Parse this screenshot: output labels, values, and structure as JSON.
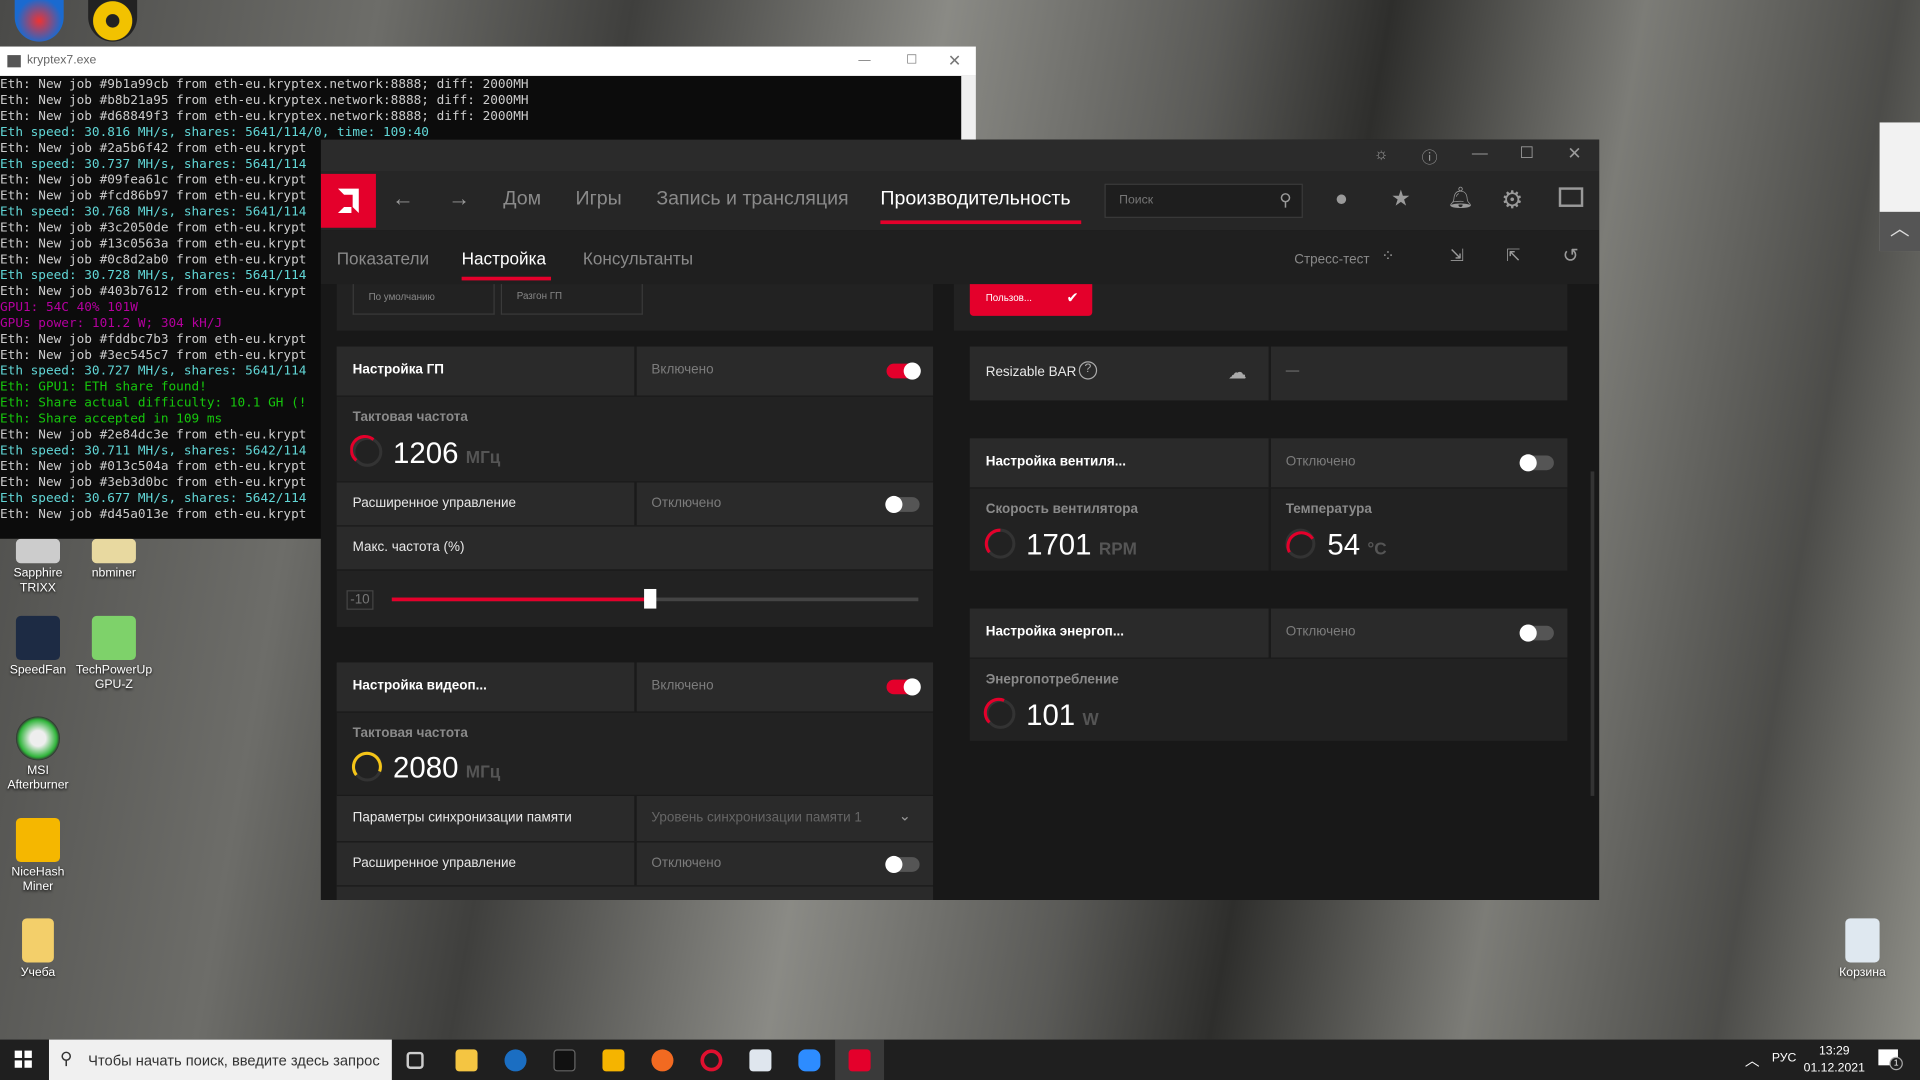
{
  "desktop": {
    "icons": [
      "Sapphire TRIXX",
      "nbminer",
      "SpeedFan",
      "TechPowerUp GPU-Z",
      "MSI Afterburner",
      "NiceHash Miner",
      "Учеба",
      "Корзина"
    ]
  },
  "console": {
    "title": "kryptex7.exe",
    "lines": [
      {
        "t": "Eth: New job #9b1a99cb from eth-eu.kryptex.network:8888; diff: 2000MH",
        "k": "w"
      },
      {
        "t": "Eth: New job #b8b21a95 from eth-eu.kryptex.network:8888; diff: 2000MH",
        "k": "w"
      },
      {
        "t": "Eth: New job #d68849f3 from eth-eu.kryptex.network:8888; diff: 2000MH",
        "k": "w"
      },
      {
        "t": "Eth speed: 30.816 MH/s, shares: 5641/114/0, time: 109:40",
        "k": "c"
      },
      {
        "t": "Eth: New job #2a5b6f42 from eth-eu.krypt",
        "k": "w"
      },
      {
        "t": "Eth speed: 30.737 MH/s, shares: 5641/114",
        "k": "c"
      },
      {
        "t": "Eth: New job #09fea61c from eth-eu.krypt",
        "k": "w"
      },
      {
        "t": "Eth: New job #fcd86b97 from eth-eu.krypt",
        "k": "w"
      },
      {
        "t": "Eth speed: 30.768 MH/s, shares: 5641/114",
        "k": "c"
      },
      {
        "t": "Eth: New job #3c2050de from eth-eu.krypt",
        "k": "w"
      },
      {
        "t": "Eth: New job #13c0563a from eth-eu.krypt",
        "k": "w"
      },
      {
        "t": "Eth: New job #0c8d2ab0 from eth-eu.krypt",
        "k": "w"
      },
      {
        "t": "Eth speed: 30.728 MH/s, shares: 5641/114",
        "k": "c"
      },
      {
        "t": "Eth: New job #403b7612 from eth-eu.krypt",
        "k": "w"
      },
      {
        "t": "GPU1: 54C 40% 101W",
        "k": "m"
      },
      {
        "t": "GPUs power: 101.2 W; 304 kH/J",
        "k": "m"
      },
      {
        "t": "Eth: New job #fddbc7b3 from eth-eu.krypt",
        "k": "w"
      },
      {
        "t": "Eth: New job #3ec545c7 from eth-eu.krypt",
        "k": "w"
      },
      {
        "t": "Eth speed: 30.727 MH/s, shares: 5641/114",
        "k": "c"
      },
      {
        "t": "Eth: GPU1: ETH share found!",
        "k": "g"
      },
      {
        "t": "Eth: Share actual difficulty: 10.1 GH (!",
        "k": "g"
      },
      {
        "t": "Eth: Share accepted in 109 ms",
        "k": "g"
      },
      {
        "t": "Eth: New job #2e84dc3e from eth-eu.krypt",
        "k": "w"
      },
      {
        "t": "Eth speed: 30.711 MH/s, shares: 5642/114",
        "k": "c"
      },
      {
        "t": "Eth: New job #013c504a from eth-eu.krypt",
        "k": "w"
      },
      {
        "t": "Eth: New job #3eb3d0bc from eth-eu.krypt",
        "k": "w"
      },
      {
        "t": "Eth speed: 30.677 MH/s, shares: 5642/114",
        "k": "c"
      },
      {
        "t": "Eth: New job #d45a013e from eth-eu.krypt",
        "k": "w"
      }
    ]
  },
  "amd": {
    "nav": {
      "home": "Дом",
      "games": "Игры",
      "record": "Запись и трансляция",
      "perf": "Производительность",
      "search_placeholder": "Поиск"
    },
    "sub": {
      "metrics": "Показатели",
      "tuning": "Настройка",
      "advisors": "Консультанты",
      "stress": "Стресс-тест"
    },
    "presets": {
      "default": "По умолчанию",
      "oc": "Разгон ГП",
      "custom": "Пользов..."
    },
    "gpu": {
      "title": "Настройка ГП",
      "state": "Включено",
      "clock_label": "Тактовая частота",
      "clock": "1206",
      "clock_unit": "МГц",
      "adv": "Расширенное управление",
      "adv_state": "Отключено",
      "maxfreq": "Макс. частота (%)",
      "slider_value": "-10",
      "slider_fill": 0.49
    },
    "vram": {
      "title": "Настройка видеоп...",
      "state": "Включено",
      "clock_label": "Тактовая частота",
      "clock": "2080",
      "clock_unit": "МГц",
      "timing": "Параметры синхронизации памяти",
      "timing_value": "Уровень синхронизации памяти 1",
      "adv": "Расширенное управление",
      "adv_state": "Отключено"
    },
    "rebar": {
      "title": "Resizable BAR",
      "value": "—"
    },
    "fan": {
      "title": "Настройка вентиля...",
      "state": "Отключено",
      "speed_label": "Скорость вентилятора",
      "speed": "1701",
      "speed_unit": "RPM",
      "temp_label": "Температура",
      "temp": "54",
      "temp_unit": "°C"
    },
    "power": {
      "title": "Настройка энергоп...",
      "state": "Отключено",
      "label": "Энергопотребление",
      "value": "101",
      "unit": "W"
    },
    "colors": {
      "accent": "#e4002b",
      "vram_gauge": "#f5c518"
    }
  },
  "taskbar": {
    "search_placeholder": "Чтобы начать поиск, введите здесь запрос",
    "lang": "РУС",
    "time": "13:29",
    "date": "01.12.2021",
    "notifications": "1"
  }
}
